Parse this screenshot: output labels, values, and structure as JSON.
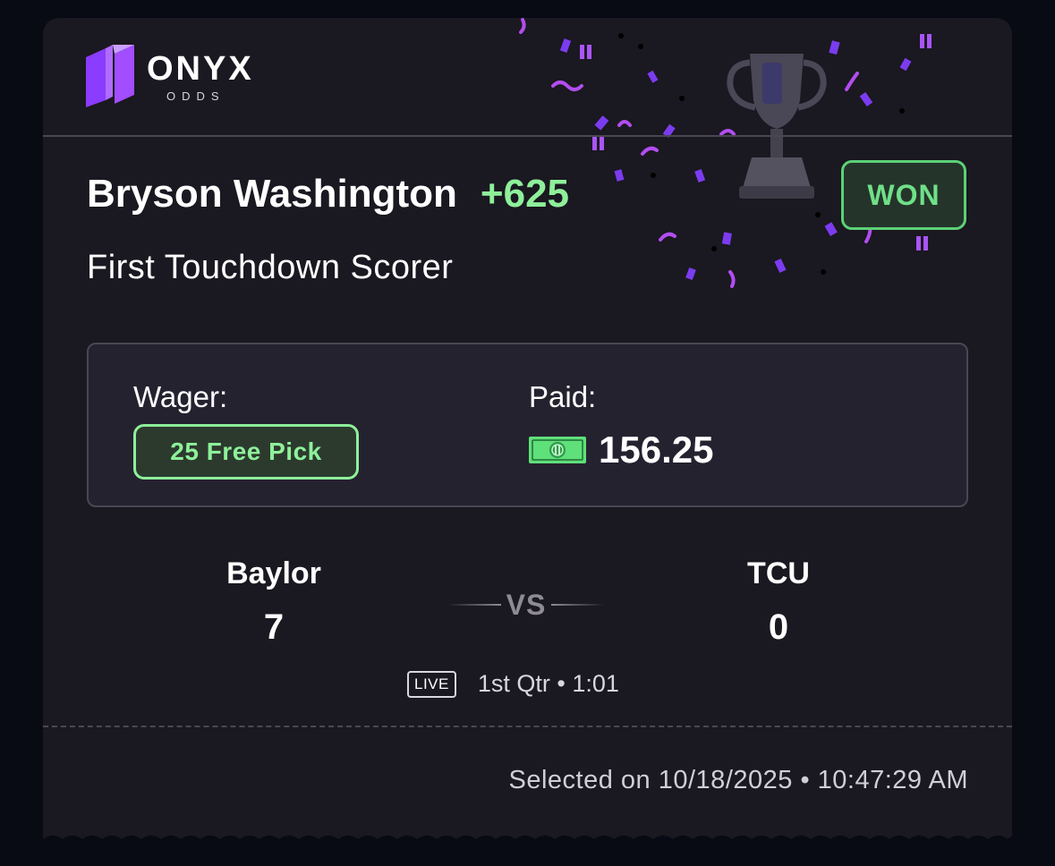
{
  "brand": {
    "name": "ONYX",
    "subtitle": "ODDS"
  },
  "bet": {
    "player": "Bryson Washington",
    "odds": "+625",
    "market": "First Touchdown Scorer",
    "status": "WON"
  },
  "wager": {
    "wager_label": "Wager:",
    "wager_value": "25 Free Pick",
    "paid_label": "Paid:",
    "paid_amount": "156.25"
  },
  "game": {
    "home_team": "Baylor",
    "home_score": "7",
    "away_team": "TCU",
    "away_score": "0",
    "vs": "VS",
    "live_badge": "LIVE",
    "clock": "1st Qtr • 1:01"
  },
  "footer": {
    "selected_on": "Selected on 10/18/2025 • 10:47:29 AM"
  },
  "colors": {
    "background": "#080a14",
    "card": "#1a1820",
    "accent_green": "#8ef09a",
    "won_green": "#6fe088",
    "brand_purple": "#9b4dff"
  },
  "icons": [
    "onyx-logo-mark",
    "cash-icon",
    "trophy-icon",
    "confetti"
  ]
}
